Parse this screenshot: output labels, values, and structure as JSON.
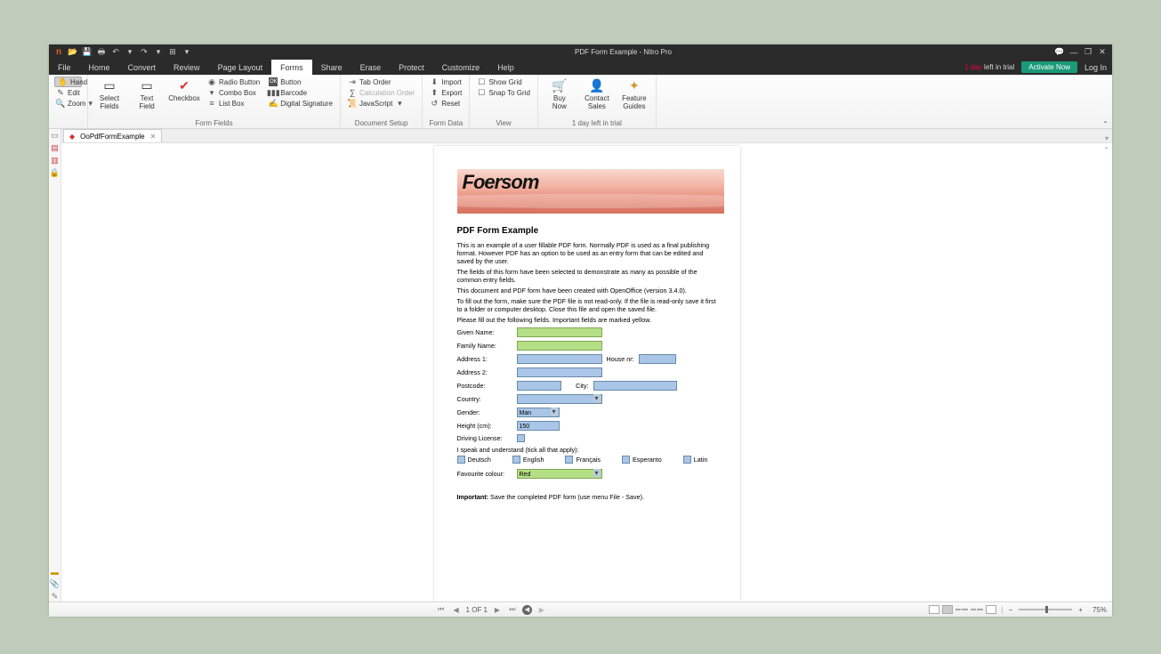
{
  "window": {
    "title": "PDF Form Example - Nitro Pro"
  },
  "qat": {
    "open": "📂",
    "save": "💾",
    "print": "🖶",
    "undo": "↶",
    "redo": "↷",
    "more": "▾"
  },
  "win_ctrl": {
    "min": "—",
    "max": "❐",
    "close": "✕",
    "chat": "💬"
  },
  "menu": {
    "file": "File",
    "home": "Home",
    "convert": "Convert",
    "review": "Review",
    "page_layout": "Page Layout",
    "forms": "Forms",
    "share": "Share",
    "erase": "Erase",
    "protect": "Protect",
    "customize": "Customize",
    "help": "Help",
    "trial_n": "1 day",
    "trial_t": "left in trial",
    "activate": "Activate Now",
    "login": "Log In"
  },
  "ribbon": {
    "g1": {
      "hand": "Hand",
      "edit": "Edit",
      "zoom": "Zoom"
    },
    "g2": {
      "select_fields": "Select\nFields",
      "text_field": "Text\nField",
      "checkbox": "Checkbox",
      "radio": "Radio Button",
      "button": "Button",
      "combo": "Combo Box",
      "barcode": "Barcode",
      "list": "List Box",
      "sig": "Digital Signature",
      "label": "Form Fields"
    },
    "g3": {
      "tab": "Tab Order",
      "calc": "Calculation Order",
      "js": "JavaScript",
      "label": "Document Setup"
    },
    "g4": {
      "import": "Import",
      "export": "Export",
      "reset": "Reset",
      "label": "Form Data"
    },
    "g5": {
      "show_grid": "Show Grid",
      "snap": "Snap To Grid",
      "label": "View"
    },
    "g6": {
      "buy1": "Buy",
      "buy2": "Now",
      "contact1": "Contact",
      "contact2": "Sales",
      "guide1": "Feature",
      "guide2": "Guides",
      "label": "1 day left in trial"
    }
  },
  "doc_tab": {
    "name": "OoPdfFormExample"
  },
  "page": {
    "brand": "Foersom",
    "h2": "PDF Form Example",
    "p1": "This is an example of a user fillable PDF form. Normally PDF is used as a final publishing format. However PDF has an option to be used as an entry form that can be edited and saved by the user.",
    "p2": "The fields of this form have been selected to demonstrate as many as possible of the common entry fields.",
    "p3": "This document and PDF form have been created with OpenOffice (version 3.4.0).",
    "p4": "To fill out the form, make sure the PDF file is not read-only. If the file is read-only save it first to a folder or computer desktop. Close this file and open the saved file.",
    "p5": "Please fill out the following fields. Important fields are marked yellow.",
    "labels": {
      "given": "Given Name:",
      "family": "Family Name:",
      "addr1": "Address 1:",
      "house": "House nr:",
      "addr2": "Address 2:",
      "postcode": "Postcode:",
      "city": "City:",
      "country": "Country:",
      "gender": "Gender:",
      "height": "Height (cm):",
      "driving": "Driving License:",
      "speak": "I speak and understand (tick all that apply):",
      "fav": "Favourite colour:",
      "important": "Important:",
      "important_t": "Save the completed PDF form (use menu File - Save)."
    },
    "values": {
      "gender": "Man",
      "height": "150",
      "fav": "Red"
    },
    "langs": {
      "de": "Deutsch",
      "en": "English",
      "fr": "Français",
      "eo": "Esperanto",
      "la": "Latin"
    }
  },
  "status": {
    "page_ind": "1 OF 1",
    "zoom": "75%"
  }
}
